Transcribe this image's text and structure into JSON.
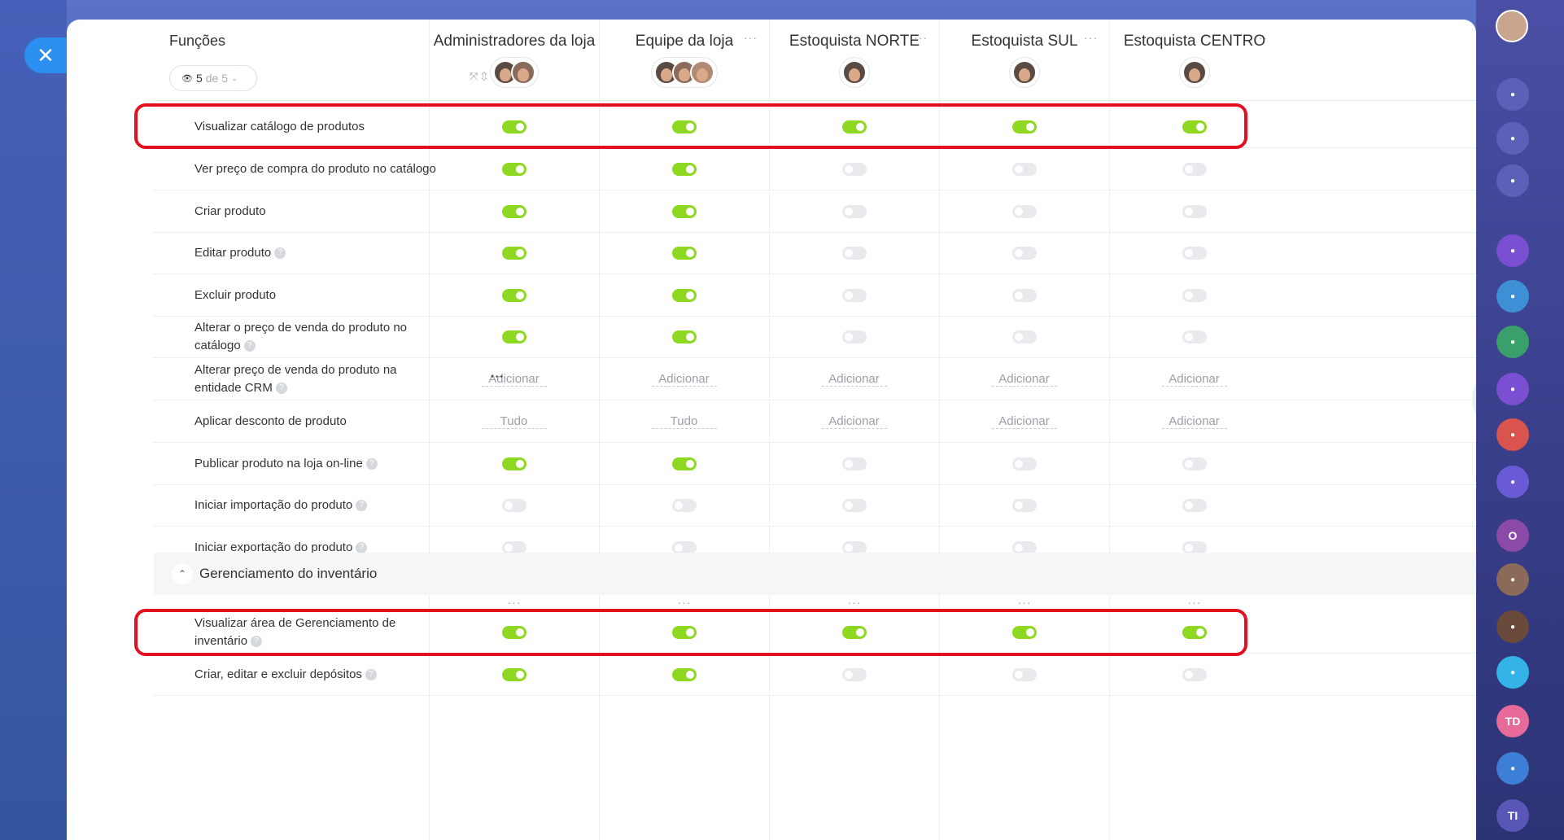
{
  "header": {
    "funcoes_label": "Funções",
    "filter_count": "5",
    "filter_of": "de 5"
  },
  "columns": [
    {
      "title": "Administradores da loja",
      "avatars": 2
    },
    {
      "title": "Equipe da loja",
      "avatars": 3
    },
    {
      "title": "Estoquista NORTE",
      "avatars": 1
    },
    {
      "title": "Estoquista SUL",
      "avatars": 1
    },
    {
      "title": "Estoquista CENTRO",
      "avatars": 1
    }
  ],
  "rows": [
    {
      "label": "Visualizar catálogo de produtos",
      "help": false,
      "cells": [
        true,
        true,
        true,
        true,
        true
      ]
    },
    {
      "label": "Ver preço de compra do produto no catálogo",
      "help": false,
      "cells": [
        true,
        true,
        false,
        false,
        false
      ]
    },
    {
      "label": "Criar produto",
      "help": false,
      "cells": [
        true,
        true,
        false,
        false,
        false
      ]
    },
    {
      "label": "Editar produto",
      "help": true,
      "cells": [
        true,
        true,
        false,
        false,
        false
      ]
    },
    {
      "label": "Excluir produto",
      "help": false,
      "cells": [
        true,
        true,
        false,
        false,
        false
      ]
    },
    {
      "label": "Alterar o preço de venda do produto no catálogo",
      "help": true,
      "cells": [
        true,
        true,
        false,
        false,
        false
      ]
    },
    {
      "label": "Alterar preço de venda do produto na entidade CRM",
      "help": true,
      "cells": [
        "Adicionar",
        "Adicionar",
        "Adicionar",
        "Adicionar",
        "Adicionar"
      ]
    },
    {
      "label": "Aplicar desconto de produto",
      "help": false,
      "cells": [
        "Tudo",
        "Tudo",
        "Adicionar",
        "Adicionar",
        "Adicionar"
      ]
    },
    {
      "label": "Publicar produto na loja on-line",
      "help": true,
      "cells": [
        true,
        true,
        false,
        false,
        false
      ]
    },
    {
      "label": "Iniciar importação do produto",
      "help": true,
      "cells": [
        false,
        false,
        false,
        false,
        false
      ]
    },
    {
      "label": "Iniciar exportação do produto",
      "help": true,
      "cells": [
        false,
        false,
        false,
        false,
        false
      ]
    }
  ],
  "section": {
    "label": "Gerenciamento do inventário",
    "rows": [
      {
        "label": "Visualizar área de Gerenciamento de inventário",
        "help": true,
        "cells": [
          true,
          true,
          true,
          true,
          true
        ]
      },
      {
        "label": "Criar, editar e excluir depósitos",
        "help": true,
        "cells": [
          true,
          true,
          false,
          false,
          false
        ]
      }
    ]
  },
  "right_sidebar": {
    "items": [
      {
        "icon": "bell-icon",
        "color": "#5b61b8"
      },
      {
        "icon": "target-icon",
        "color": "#5b61b8"
      },
      {
        "icon": "refresh-icon",
        "color": "#5b61b8"
      },
      {
        "icon": "radar-icon",
        "color": "#7a4fd1"
      },
      {
        "icon": "checkbox-icon",
        "color": "#3d8fd6"
      },
      {
        "icon": "group-icon",
        "color": "#39a06b"
      },
      {
        "icon": "radar-icon",
        "color": "#7a4fd1"
      },
      {
        "icon": "group-icon",
        "color": "#d9534f"
      },
      {
        "icon": "radar-icon",
        "color": "#6a5ad6"
      },
      {
        "icon": "o-icon",
        "color": "#8b4aa8",
        "text": "O"
      },
      {
        "icon": "avatar-icon",
        "color": "#8b6a5a"
      },
      {
        "icon": "avatar-icon",
        "color": "#6a4a3a"
      },
      {
        "icon": "chat-icon",
        "color": "#33b3e8"
      },
      {
        "icon": "td-icon",
        "color": "#e86a9a",
        "text": "TD"
      },
      {
        "icon": "bookmark-icon",
        "color": "#3d7fd6"
      },
      {
        "icon": "ti-icon",
        "color": "#5a56b8",
        "text": "TI"
      }
    ]
  },
  "colors": {
    "toggle_on": "#8fd822",
    "toggle_off": "#e8eaed",
    "highlight": "#e30f1e",
    "close_button": "#2a8ff0"
  }
}
